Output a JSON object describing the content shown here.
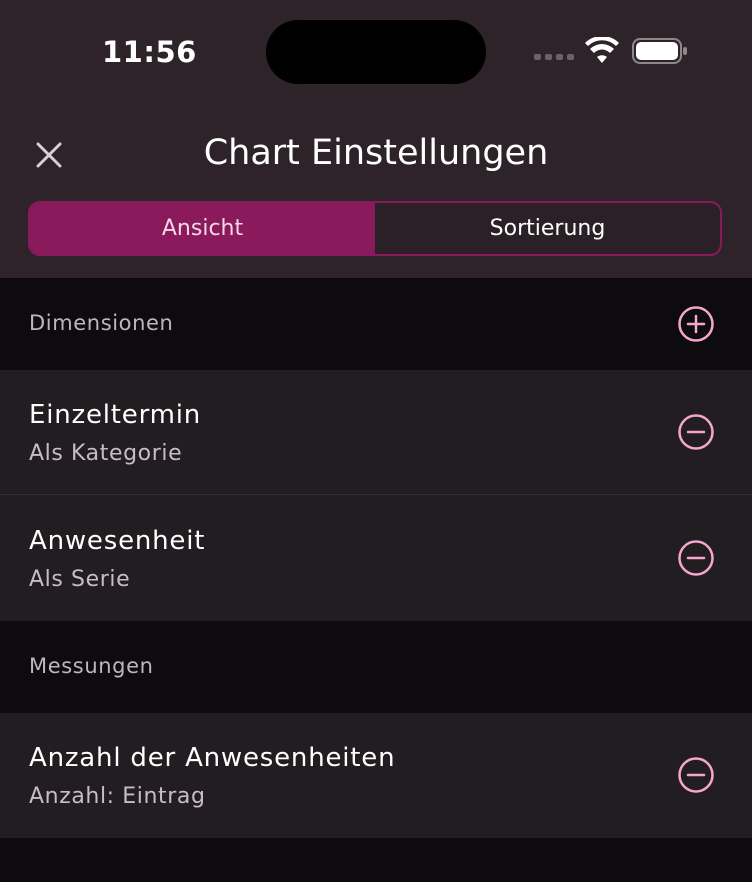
{
  "status_bar": {
    "time": "11:56",
    "wifi_icon": "wifi-icon",
    "battery_icon": "battery-icon"
  },
  "header": {
    "title": "Chart Einstellungen",
    "close_icon": "close-icon"
  },
  "tabs": [
    {
      "label": "Ansicht",
      "active": true
    },
    {
      "label": "Sortierung",
      "active": false
    }
  ],
  "sections": {
    "dimensions": {
      "title": "Dimensionen",
      "add_icon": "plus-circle-icon",
      "items": [
        {
          "title": "Einzeltermin",
          "subtitle": "Als Kategorie",
          "remove_icon": "minus-circle-icon"
        },
        {
          "title": "Anwesenheit",
          "subtitle": "Als Serie",
          "remove_icon": "minus-circle-icon"
        }
      ]
    },
    "measures": {
      "title": "Messungen",
      "items": [
        {
          "title": "Anzahl der Anwesenheiten",
          "subtitle": "Anzahl: Eintrag",
          "remove_icon": "minus-circle-icon"
        }
      ]
    }
  },
  "colors": {
    "accent": "#8a1a5c",
    "icon_accent": "#f4a6cd",
    "header_bg": "#2d2329",
    "section_bg": "#0e0b0e",
    "row_bg": "#211d20"
  }
}
